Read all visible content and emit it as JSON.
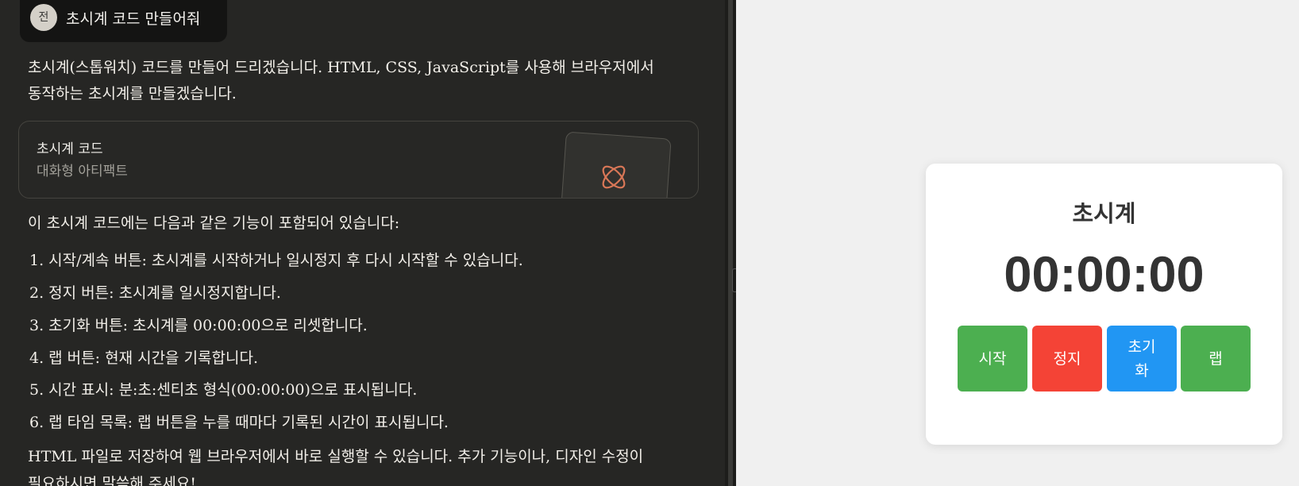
{
  "chat": {
    "user": {
      "avatar_initial": "전",
      "message": "초시계 코드 만들어줘"
    },
    "intro_line1": "초시계(스톱워치) 코드를 만들어 드리겠습니다. HTML, CSS, JavaScript를 사용해 브라우저에서",
    "intro_line2": "동작하는 초시계를 만들겠습니다.",
    "artifact": {
      "title": "초시계 코드",
      "subtitle": "대화형 아티팩트",
      "icon": "atom-icon"
    },
    "features_heading": "이 초시계 코드에는 다음과 같은 기능이 포함되어 있습니다:",
    "features": [
      "1. 시작/계속 버튼: 초시계를 시작하거나 일시정지 후 다시 시작할 수 있습니다.",
      "2. 정지 버튼: 초시계를 일시정지합니다.",
      "3. 초기화 버튼: 초시계를 00:00:00으로 리셋합니다.",
      "4. 랩 버튼: 현재 시간을 기록합니다.",
      "5. 시간 표시: 분:초:센티초 형식(00:00:00)으로 표시됩니다.",
      "6. 랩 타임 목록: 랩 버튼을 누를 때마다 기록된 시간이 표시됩니다."
    ],
    "closing_line1": "HTML 파일로 저장하여 웹 브라우저에서 바로 실행할 수 있습니다. 추가 기능이나, 디자인 수정이",
    "closing_line2": "필요하시면 말씀해 주세요!"
  },
  "preview": {
    "title": "초시계",
    "time": "00:00:00",
    "buttons": {
      "start": "시작",
      "stop": "정지",
      "reset_line1": "초기",
      "reset_line2": "화",
      "lap": "랩"
    }
  },
  "colors": {
    "start": "#4caf50",
    "stop": "#f44336",
    "reset": "#2196f3",
    "lap": "#4caf50",
    "accent": "#d97757"
  }
}
